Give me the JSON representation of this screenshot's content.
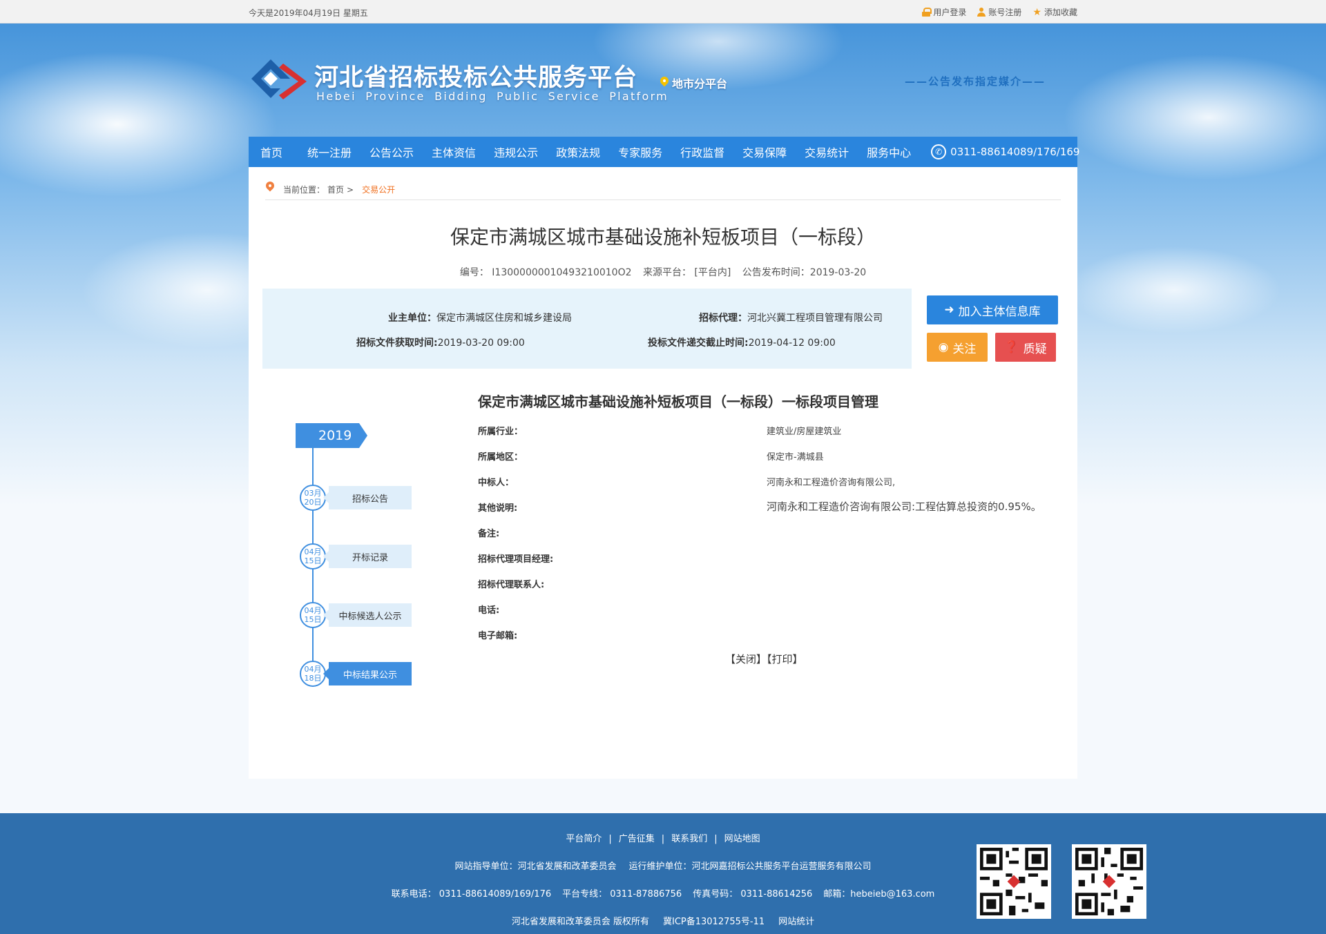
{
  "topbar": {
    "date": "今天是2019年04月19日 星期五",
    "login": "用户登录",
    "register": "账号注册",
    "favorite": "添加收藏"
  },
  "header": {
    "title": "河北省招标投标公共服务平台",
    "subtitle": "Hebei Province Bidding Public Service Platform",
    "branch": "地市分平台",
    "media": "——公告发布指定媒介——"
  },
  "nav": {
    "items": [
      "首页",
      "统一注册",
      "公告公示",
      "主体资信",
      "违规公示",
      "政策法规",
      "专家服务",
      "行政监督",
      "交易保障",
      "交易统计",
      "服务中心"
    ],
    "phone": "0311-88614089/176/169"
  },
  "breadcrumb": {
    "label": "当前位置：",
    "home": "首页",
    "sep": ">",
    "current": "交易公开"
  },
  "article": {
    "title": "保定市满城区城市基础设施补短板项目（一标段）",
    "meta_code": "编号： I13000000010493210010O2",
    "meta_source": "来源平台：  [平台内]",
    "meta_date": "公告发布时间：2019-03-20"
  },
  "info": {
    "owner_label": "业主单位：",
    "owner_value": "保定市满城区住房和城乡建设局",
    "agent_label": "招标代理：",
    "agent_value": "河北兴冀工程项目管理有限公司",
    "doc_time_label": "招标文件获取时间:",
    "doc_time_value": "2019-03-20 09:00",
    "deadline_label": "投标文件递交截止时间:",
    "deadline_value": "2019-04-12 09:00"
  },
  "buttons": {
    "add": "加入主体信息库",
    "follow": "关注",
    "question": "质疑"
  },
  "detail": {
    "title": "保定市满城区城市基础设施补短板项目（一标段）一标段项目管理",
    "fields": [
      {
        "label": "所属行业：",
        "value": "建筑业/房屋建筑业"
      },
      {
        "label": "所属地区：",
        "value": "保定市-满城县"
      },
      {
        "label": "中标人：",
        "value": "河南永和工程造价咨询有限公司,"
      },
      {
        "label": "其他说明:",
        "value": "河南永和工程造价咨询有限公司:工程估算总投资的0.95%。"
      },
      {
        "label": "备注:",
        "value": ""
      },
      {
        "label": "招标代理项目经理:",
        "value": ""
      },
      {
        "label": "招标代理联系人:",
        "value": ""
      },
      {
        "label": "电话:",
        "value": ""
      },
      {
        "label": "电子邮箱:",
        "value": ""
      }
    ],
    "close": "【关闭】",
    "print": "【打印】"
  },
  "timeline": {
    "year": "2019",
    "events": [
      {
        "month": "03月",
        "day": "20日",
        "label": "招标公告",
        "active": false
      },
      {
        "month": "04月",
        "day": "15日",
        "label": "开标记录",
        "active": false
      },
      {
        "month": "04月",
        "day": "15日",
        "label": "中标候选人公示",
        "active": false
      },
      {
        "month": "04月",
        "day": "18日",
        "label": "中标结果公示",
        "active": true
      }
    ]
  },
  "footer": {
    "links": [
      "平台简介",
      "广告征集",
      "联系我们",
      "网站地图"
    ],
    "sep": "|",
    "guide": "网站指导单位：河北省发展和改革委员会",
    "operator": "运行维护单位：河北网嘉招标公共服务平台运营服务有限公司",
    "contact_phone": "联系电话： 0311-88614089/169/176",
    "hotline": "平台专线： 0311-87886756",
    "fax": "传真号码： 0311-88614256",
    "email": "邮箱：hebeieb@163.com",
    "copyright": "河北省发展和改革委员会 版权所有",
    "icp": "冀ICP备13012755号-11",
    "stats": "网站统计"
  },
  "colors": {
    "nav_blue": "#2a85dd",
    "footer_blue": "#2f6fad",
    "accent_orange": "#f07020",
    "follow_orange": "#f5a030",
    "question_red": "#e65050"
  }
}
